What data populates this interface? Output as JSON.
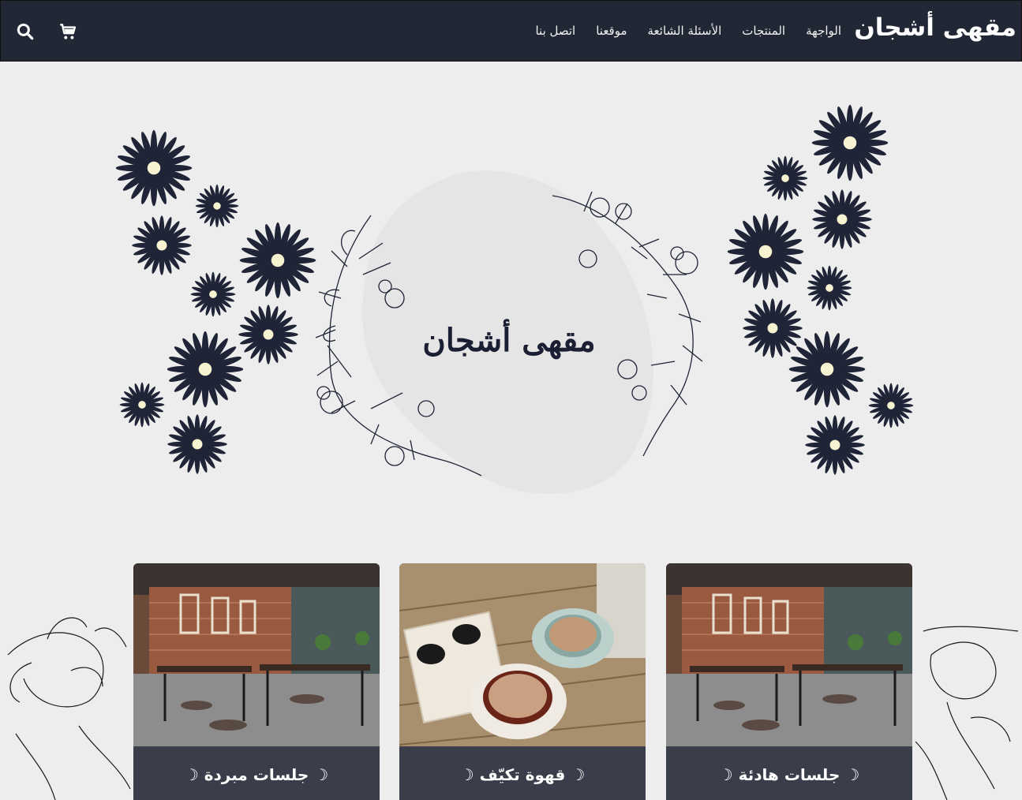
{
  "navbar": {
    "brand": "مقهى أشجان",
    "links": [
      {
        "label": "الواجهة"
      },
      {
        "label": "المنتجات"
      },
      {
        "label": "الأسئلة الشائعة"
      },
      {
        "label": "موقعنا"
      },
      {
        "label": "اتصل بنا"
      }
    ],
    "icons": [
      "search-icon",
      "cart-icon"
    ]
  },
  "hero": {
    "title": "مقهى أشجان"
  },
  "cards": [
    {
      "caption": "☽ جلسات هادئة ☽",
      "image": "cafe-interior"
    },
    {
      "caption": "☽ قهوة تكيّف ☽",
      "image": "coffee-cups"
    },
    {
      "caption": "☽ جلسات مبردة ☽",
      "image": "cafe-interior"
    }
  ],
  "colors": {
    "navbar": "#212735",
    "background": "#ededed",
    "card_caption": "#3a3e4a",
    "flower": "#1f2536",
    "flower_center": "#f7f2d0"
  }
}
